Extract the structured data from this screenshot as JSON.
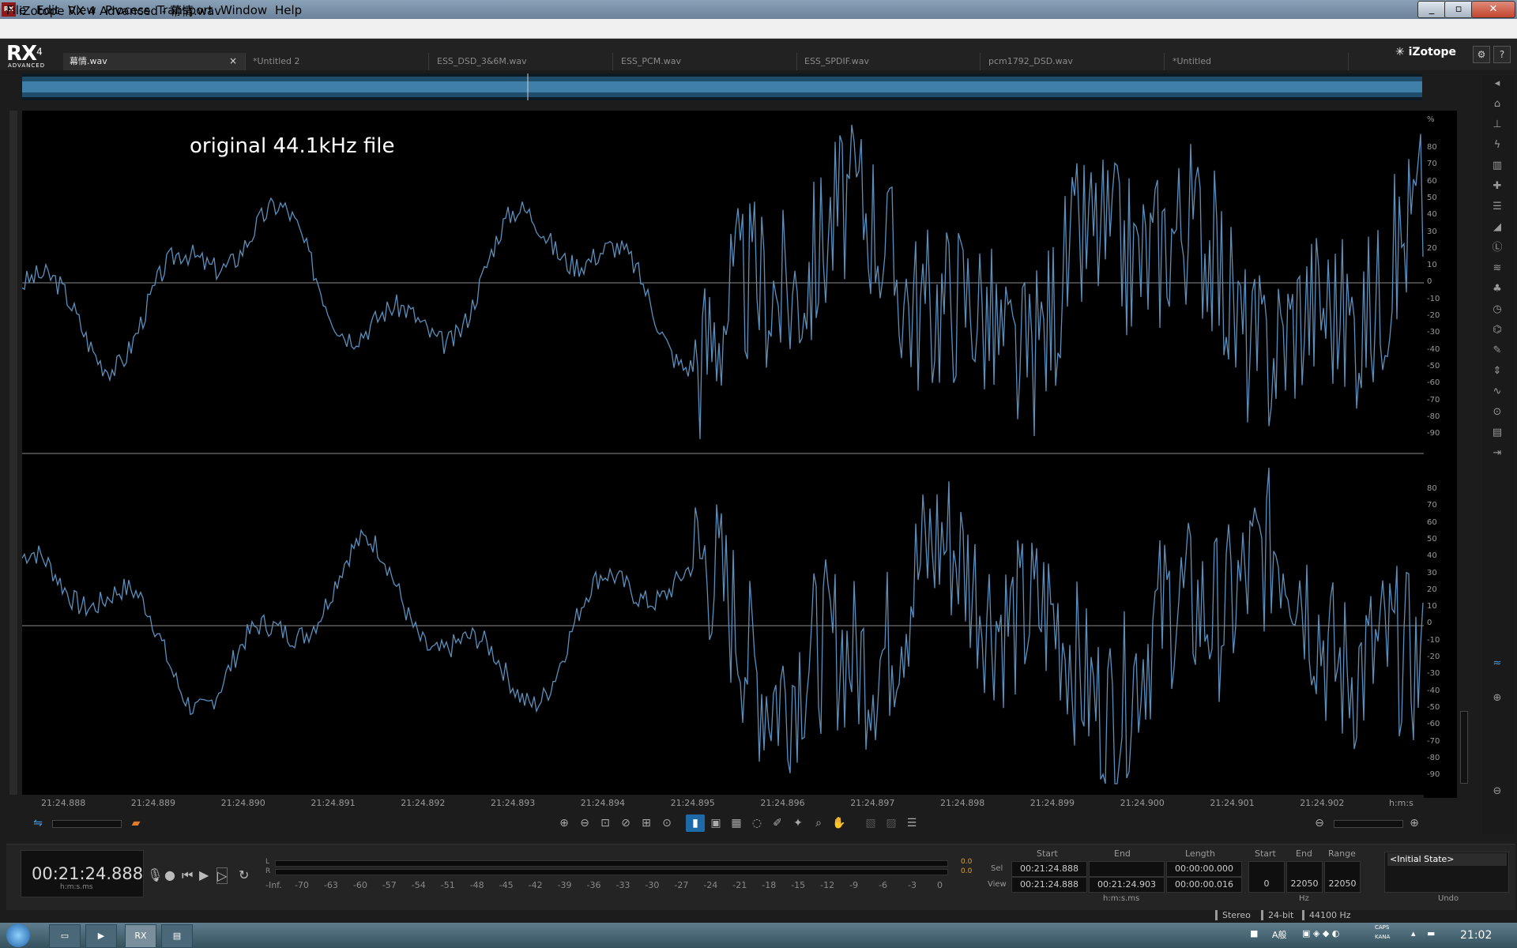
{
  "window": {
    "title": "iZotope RX 4 Advanced - 幕情.wav",
    "app_icon": "RX",
    "controls": [
      "_",
      "▫",
      "✕"
    ]
  },
  "menu": [
    "File",
    "Edit",
    "View",
    "Process",
    "Transport",
    "Window",
    "Help"
  ],
  "app": {
    "logo": "RX",
    "logo_version": "4",
    "logo_sub": "ADVANCED",
    "brand": "iZotope"
  },
  "tabs": [
    {
      "label": "幕情.wav",
      "active": true
    },
    {
      "label": "*Untitled 2",
      "active": false
    },
    {
      "label": "ESS_DSD_3&6M.wav",
      "active": false
    },
    {
      "label": "ESS_PCM.wav",
      "active": false
    },
    {
      "label": "ESS_SPDIF.wav",
      "active": false
    },
    {
      "label": "pcm1792_DSD.wav",
      "active": false
    },
    {
      "label": "*Untitled",
      "active": false
    }
  ],
  "tab_close": "×",
  "annotation": "original 44.1kHz file",
  "amplitude_scale": {
    "unit": "%",
    "top": [
      "80",
      "70",
      "60",
      "50",
      "40",
      "30",
      "20",
      "10",
      "0",
      "-10",
      "-20",
      "-30",
      "-40",
      "-50",
      "-60",
      "-70",
      "-80",
      "-90"
    ],
    "bottom": [
      "80",
      "70",
      "60",
      "50",
      "40",
      "30",
      "20",
      "10",
      "0",
      "-10",
      "-20",
      "-30",
      "-40",
      "-50",
      "-60",
      "-70",
      "-80",
      "-90"
    ]
  },
  "time_ticks": [
    "21:24.888",
    "21:24.889",
    "21:24.890",
    "21:24.891",
    "21:24.892",
    "21:24.893",
    "21:24.894",
    "21:24.895",
    "21:24.896",
    "21:24.897",
    "21:24.898",
    "21:24.899",
    "21:24.900",
    "21:24.901",
    "21:24.902"
  ],
  "time_unit": "h:m:s",
  "colors": {
    "waveform": "#5b8fbd",
    "background": "#000000",
    "accent": "#1e6aa8"
  },
  "transport": {
    "timecode": "00:21:24.888",
    "timecode_unit": "h:m:s.ms",
    "meter_channels": [
      "L",
      "R"
    ],
    "meter_values": [
      "0.0",
      "0.0"
    ],
    "meter_scale": [
      "-Inf.",
      "-70",
      "-63",
      "-60",
      "-57",
      "-54",
      "-51",
      "-48",
      "-45",
      "-42",
      "-39",
      "-36",
      "-33",
      "-30",
      "-27",
      "-24",
      "-21",
      "-18",
      "-15",
      "-12",
      "-9",
      "-6",
      "-3",
      "0"
    ]
  },
  "selection": {
    "headers": [
      "Start",
      "End",
      "Length",
      "Start",
      "End",
      "Range"
    ],
    "row_labels": [
      "Sel",
      "View"
    ],
    "sel": {
      "start": "00:21:24.888",
      "end": "",
      "length": "00:00:00.000"
    },
    "view": {
      "start": "00:21:24.888",
      "end": "00:21:24.903",
      "length": "00:00:00.016"
    },
    "freq": {
      "start": "0",
      "end": "22050",
      "range": "22050"
    },
    "time_unit": "h:m:s.ms",
    "freq_unit": "Hz"
  },
  "history": {
    "item": "<Initial State>",
    "label": "Undo"
  },
  "status": [
    "Stereo",
    "24-bit",
    "44100 Hz"
  ],
  "taskbar": {
    "clock": "21:02",
    "tray_text": "A般",
    "caps": "CAPS",
    "kana": "KANA"
  }
}
